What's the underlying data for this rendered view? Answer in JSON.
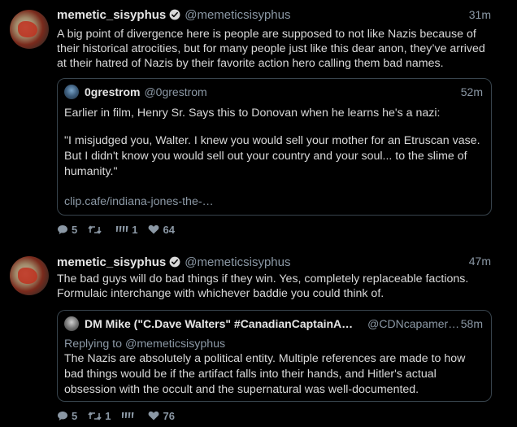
{
  "tweets": [
    {
      "author_name": "memetic_sisyphus",
      "author_handle": "@memeticsisyphus",
      "time": "31m",
      "text": "A big point of divergence here is people are supposed to not like Nazis because of their historical atrocities, but for many people just like this dear anon, they’ve arrived at their hatred of Nazis by their favorite action hero calling them bad names.",
      "quote": {
        "author_name": "0grestrom",
        "author_handle": "@0grestrom",
        "time": "52m",
        "text_1": "Earlier in film, Henry Sr. Says this to Donovan when he learns he's a nazi:",
        "text_2": "\"I misjudged you, Walter. I knew you would sell your mother for an Etruscan vase. But I didn't know you would sell out your country and your soul... to the slime of humanity.\"",
        "link": "clip.cafe/indiana-jones-the-…"
      },
      "actions": {
        "replies": "5",
        "retweets": "",
        "quotes": "1",
        "likes": "64"
      }
    },
    {
      "author_name": "memetic_sisyphus",
      "author_handle": "@memeticsisyphus",
      "time": "47m",
      "text": "The bad guys will do bad things if they win. Yes, completely replaceable factions. Formulaic interchange with whichever baddie you could think of.",
      "quote": {
        "author_name": "DM Mike (\"C.Dave Walters\" #CanadianCaptainA…",
        "author_handle": "@CDNcapamer…",
        "time": "58m",
        "replying_label": "Replying to",
        "replying_handle": "@memeticsisyphus",
        "text_1": "The Nazis are absolutely a political entity. Multiple references are made to how bad things would be if the artifact falls into their hands, and Hitler's actual obsession with the occult and the supernatural was well-documented."
      },
      "actions": {
        "replies": "5",
        "retweets": "1",
        "quotes": "",
        "likes": "76"
      }
    }
  ],
  "icons": {
    "reply": "speech-bubble-icon",
    "retweet": "retweet-icon",
    "quote": "quote-icon",
    "like": "heart-icon",
    "verified": "verified-badge-icon"
  },
  "colors": {
    "background": "#000000",
    "text": "#d9d9d9",
    "muted": "#8b98a5",
    "border": "#38444d",
    "verified": "#d9d9d9"
  }
}
